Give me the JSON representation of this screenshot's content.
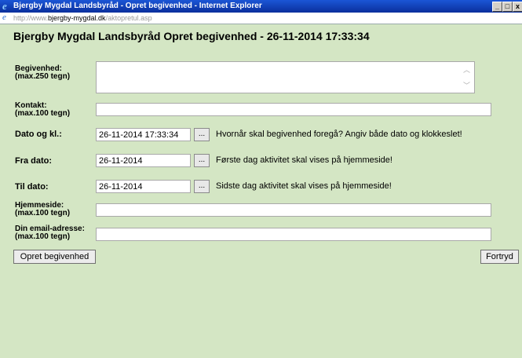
{
  "window": {
    "title": "Bjergby Mygdal Landsbyråd - Opret begivenhed - Internet Explorer",
    "url_prefix": "http://www.",
    "url_domain": "bjergby-mygdal.dk",
    "url_path": "/aktopretul.asp"
  },
  "page": {
    "heading": "Bjergby Mygdal Landsbyråd  Opret begivenhed - 26-11-2014 17:33:34"
  },
  "form": {
    "begivenhed_label": "Begivenhed:\n(max.250 tegn)",
    "kontakt_label": "Kontakt:\n(max.100 tegn)",
    "dato_label": "Dato og kl.:",
    "dato_value": "26-11-2014 17:33:34",
    "dato_hint": "Hvornår skal begivenhed foregå? Angiv både dato og klokkeslet!",
    "fra_label": "Fra dato:",
    "fra_value": "26-11-2014",
    "fra_hint": "Første dag aktivitet skal vises på hjemmeside!",
    "til_label": "Til dato:",
    "til_value": "26-11-2014",
    "til_hint": "Sidste dag aktivitet skal vises på hjemmeside!",
    "hjemmeside_label": "Hjemmeside:\n(max.100 tegn)",
    "email_label": "Din email-adresse:\n(max.100 tegn)",
    "picker_label": "...",
    "submit_label": "Opret begivenhed",
    "cancel_label": "Fortryd"
  },
  "icons": {
    "browser": "internet-explorer-icon",
    "minimize": "minimize-icon",
    "maximize": "maximize-icon",
    "close": "close-icon"
  }
}
